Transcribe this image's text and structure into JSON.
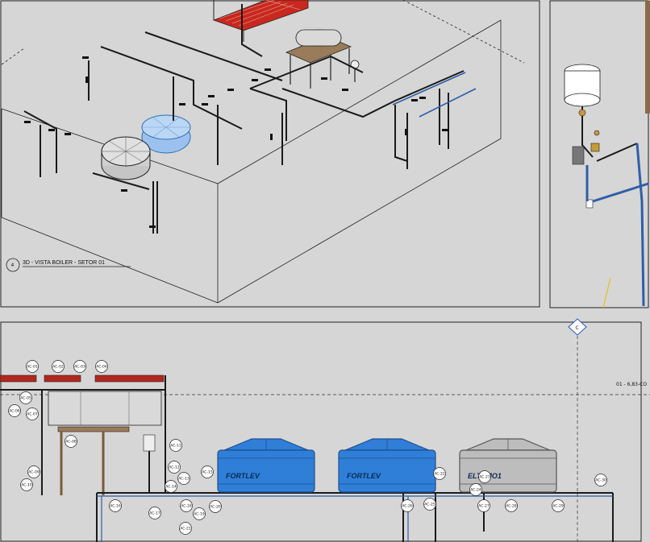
{
  "view_3d": {
    "view_number": "4",
    "view_title": "3D - VISTA BOILER - SETOR 01"
  },
  "section_view": {
    "level_label": "01 - 6,83-CO",
    "grid_marker": "C"
  },
  "tanks": [
    {
      "brand": "FORTLEV",
      "color": "#2f7fd8"
    },
    {
      "brand": "FORTLEV",
      "color": "#2f7fd8"
    },
    {
      "brand": "ELTEMO1",
      "color": "#bdbdbd"
    }
  ],
  "pipe_tags": [
    "AC-01",
    "AC-02",
    "AC-03",
    "AC-04",
    "AC-05",
    "AC-06",
    "AC-07",
    "AC-08",
    "AC-09",
    "AC-10",
    "AC-11",
    "AC-12",
    "AC-13",
    "AC-14",
    "AC-15",
    "AC-16",
    "AC-17",
    "AC-18",
    "AC-19",
    "AC-20",
    "AC-21",
    "AC-22",
    "AC-23",
    "AC-24",
    "AC-25",
    "AC-26",
    "AC-27",
    "AC-28",
    "AC-29",
    "AC-30"
  ],
  "colors": {
    "background": "#d6d6d6",
    "pipe": "#1a1a1a",
    "hot_pipe": "#b3261e",
    "tank_blue": "#2f7fd8",
    "pipe_blue": "#2f5ea8"
  }
}
